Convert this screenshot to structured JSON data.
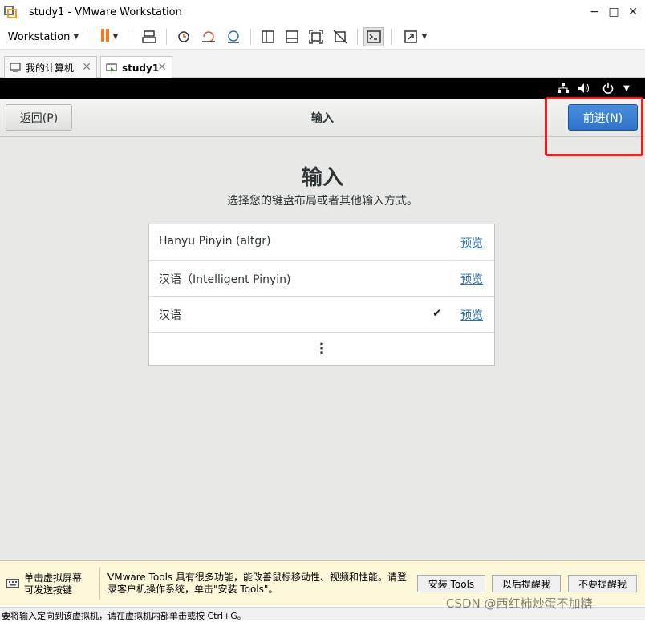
{
  "window": {
    "title": "study1 - VMware Workstation",
    "minimize": "−",
    "maximize": "□",
    "close": "✕"
  },
  "toolbar": {
    "workstation_label": "Workstation",
    "icons": [
      "pause-icon",
      "send-keys-icon",
      "snapshot-icon",
      "revert-snapshot-icon",
      "snapshot-manager-icon",
      "view-normal-icon",
      "view-tabs-icon",
      "fit-guest-icon",
      "unity-icon",
      "console-icon",
      "fullscreen-icon"
    ]
  },
  "tabs": [
    {
      "label": "我的计算机",
      "close": "✕"
    },
    {
      "label": "study1",
      "close": "✕"
    }
  ],
  "guest": {
    "header": {
      "back_label": "返回(P)",
      "title": "输入",
      "next_label": "前进(N)"
    },
    "heading": "输入",
    "subtitle": "选择您的键盘布局或者其他输入方式。",
    "rows": [
      {
        "label": "Hanyu Pinyin (altgr)",
        "preview": "预览",
        "check": ""
      },
      {
        "label": "汉语（Intelligent Pinyin)",
        "preview": "预览",
        "check": ""
      },
      {
        "label": "汉语",
        "preview": "预览",
        "check": "✔"
      }
    ],
    "more": "⋮",
    "accent_color": "#3a80d5",
    "highlight_color": "#f21c1c"
  },
  "notification": {
    "left_text": "单击虚拟屏幕\n可发送按键",
    "left_line1": "单击虚拟屏幕",
    "left_line2": "可发送按键",
    "message_line1": "VMware Tools 具有很多功能，能改善鼠标移动性、视频和性能。请登",
    "message_line2": "录客户机操作系统，单击\"安装 Tools\"。",
    "buttons": [
      "安装 Tools",
      "以后提醒我",
      "不要提醒我"
    ]
  },
  "status": {
    "text": "要将输入定向到该虚拟机，请在虚拟机内部单击或按 Ctrl+G。"
  },
  "watermark": "CSDN @西红柿炒蛋不加糖"
}
